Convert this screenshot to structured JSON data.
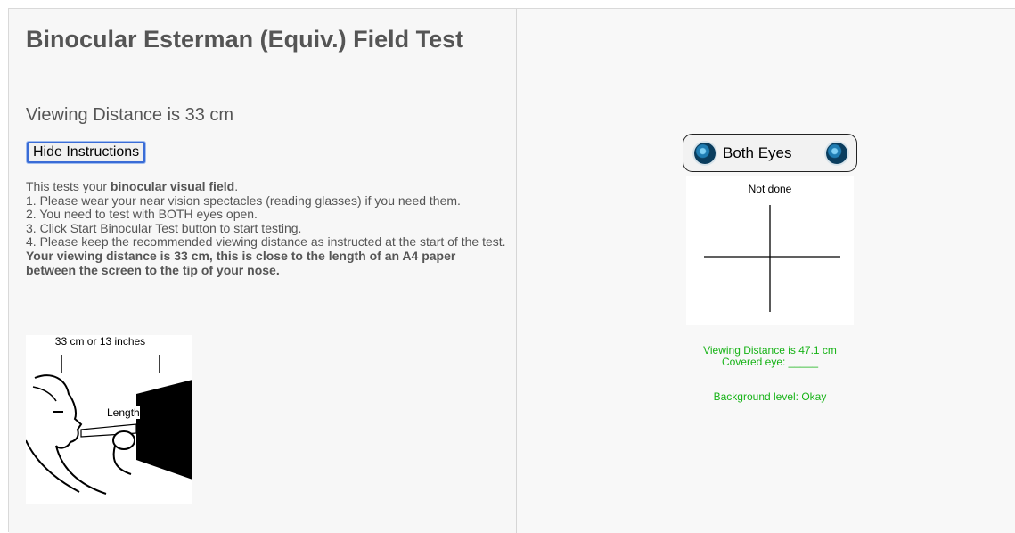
{
  "title": "Binocular Esterman (Equiv.) Field Test",
  "viewing_distance_heading": "Viewing Distance is 33 cm",
  "hide_instructions_label": "Hide Instructions",
  "instructions": {
    "intro_prefix": "This tests your ",
    "intro_bold": "binocular visual field",
    "intro_suffix": ".",
    "step1": "1. Please wear your near vision spectacles (reading glasses) if you need them.",
    "step2": "2. You need to test with BOTH eyes open.",
    "step3": "3. Click Start Binocular Test button to start testing.",
    "step4": "4. Please keep the recommended viewing distance as instructed at the start of the test.",
    "bold_note": "Your viewing distance is 33 cm, this is close to the length of an A4 paper between the screen to the tip of your nose."
  },
  "illustration": {
    "distance_label": "33 cm or 13 inches",
    "length_label": "Length"
  },
  "eye_selector": {
    "label": "Both Eyes",
    "left_icon": "eye-icon",
    "right_icon": "eye-icon"
  },
  "field_panel": {
    "status": "Not done"
  },
  "info": {
    "viewing_distance": "Viewing Distance is 47.1 cm",
    "covered_eye": "Covered eye: _____",
    "background_level": "Background level: Okay",
    "color": "#17b317"
  }
}
